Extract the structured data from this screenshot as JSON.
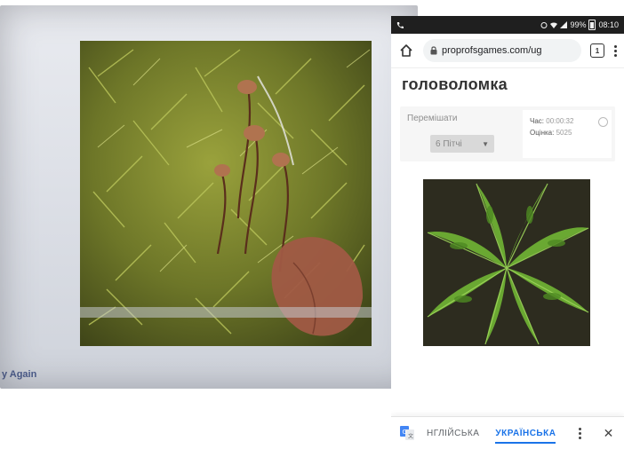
{
  "desktop": {
    "try_again_label": "y Again"
  },
  "phone": {
    "status_bar": {
      "time": "08:10",
      "battery": "99%"
    },
    "browser": {
      "url": "proprofsgames.com/ug",
      "tab_count": "1"
    },
    "page_title": "головоломка",
    "game_panel": {
      "shuffle_label": "Перемішати",
      "shuffle_select": "6 Пітчі",
      "time_label": "Час:",
      "time_value": "00:00:32",
      "score_label": "Оцінка:",
      "score_value": "5025"
    },
    "translate_bar": {
      "source_lang": "НГЛІЙСЬКА",
      "target_lang": "УКРАЇНСЬКА",
      "close_glyph": "✕"
    }
  },
  "colors": {
    "accent": "#1a73e8",
    "status_bar_bg": "#1f1f1f",
    "title_text": "#333333"
  },
  "icons": [
    "home-icon",
    "lock-icon",
    "tab-count-icon",
    "menu-dots-icon",
    "google-translate-icon",
    "more-vert-icon",
    "close-icon",
    "info-icon"
  ]
}
